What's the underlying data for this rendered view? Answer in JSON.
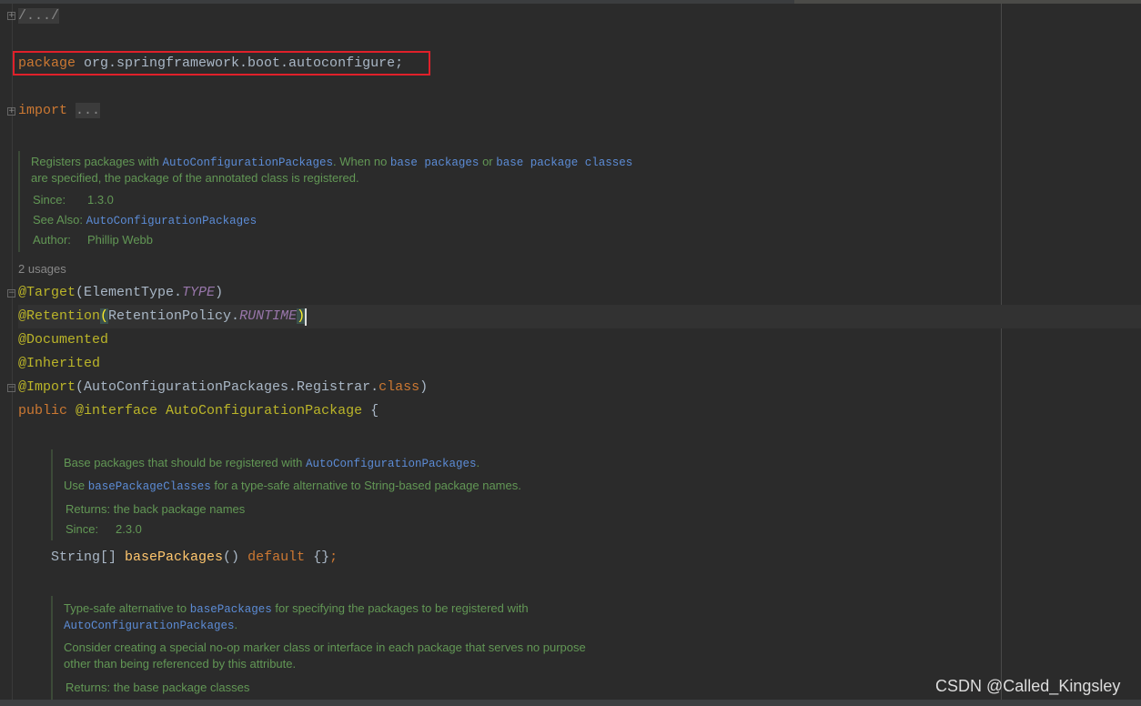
{
  "code": {
    "header_fold": "/.../",
    "package_kw": "package",
    "package_name": " org.springframework.boot.autoconfigure;",
    "import_kw": "import",
    "import_fold": "...",
    "usages": "2 usages",
    "target": {
      "ann": "@Target",
      "open": "(ElementType.",
      "const": "TYPE",
      "close": ")"
    },
    "retention": {
      "ann": "@Retention",
      "open": "(",
      "mid": "RetentionPolicy.",
      "const": "RUNTIME",
      "close": ")"
    },
    "documented": "@Documented",
    "inherited": "@Inherited",
    "import_ann": {
      "ann": "@Import",
      "mid": "(AutoConfigurationPackages.Registrar.",
      "kw": "class",
      "close": ")"
    },
    "decl": {
      "kw": "public",
      "ann": " @interface",
      "name": " AutoConfigurationPackage",
      "rest": " {"
    },
    "method1": {
      "type": "String[] ",
      "name": "basePackages",
      "mid": "() ",
      "kw": "default",
      "rest": " {}",
      "semi": ";"
    }
  },
  "doc1": {
    "l1a": "Registers packages with ",
    "l1b": "AutoConfigurationPackages",
    "l1c": ". When no ",
    "l1d": "base packages",
    "l1e": " or ",
    "l1f": "base package classes",
    "l2": "are specified, the package of the annotated class is registered.",
    "since_label": "Since:",
    "since": "1.3.0",
    "see_label": "See Also:",
    "see": "AutoConfigurationPackages",
    "author_label": "Author:",
    "author": "Phillip Webb"
  },
  "doc2": {
    "l1a": "Base packages that should be registered with ",
    "l1b": "AutoConfigurationPackages",
    "l1c": ".",
    "l2a": "Use ",
    "l2b": "basePackageClasses",
    "l2c": " for a type-safe alternative to String-based package names.",
    "returns": "Returns: the back package names",
    "since_label": "Since:",
    "since": "2.3.0"
  },
  "doc3": {
    "l1a": "Type-safe alternative to ",
    "l1b": "basePackages",
    "l1c": " for specifying the packages to be registered with",
    "l2a": "AutoConfigurationPackages",
    "l2b": ".",
    "l3": "Consider creating a special no-op marker class or interface in each package that serves no purpose",
    "l4": "other than being referenced by this attribute.",
    "returns": "Returns: the base package classes"
  },
  "watermark": "CSDN @Called_Kingsley",
  "colors": {
    "highlight_box": "#e0202a",
    "keyword": "#cc7832",
    "annotation": "#bbb529",
    "doc": "#629755",
    "doc_link": "#5c8cd6"
  }
}
